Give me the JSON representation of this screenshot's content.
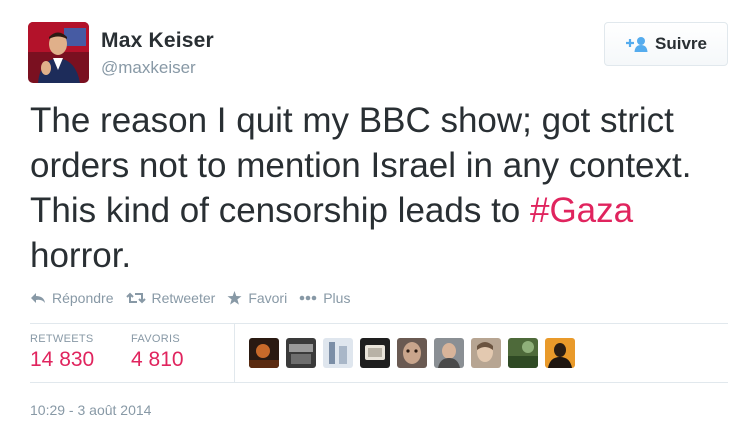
{
  "author": {
    "name": "Max Keiser",
    "handle": "@maxkeiser"
  },
  "follow_button": {
    "label": "Suivre",
    "icon": "add-user-icon"
  },
  "tweet": {
    "text_before": "The reason I quit my BBC show; got strict orders not to mention Israel in any context. This kind of censorship leads to ",
    "hashtag_symbol": "#",
    "hashtag_word": "Gaza",
    "text_after": " horror."
  },
  "actions": [
    {
      "label": "Répondre",
      "icon": "reply-icon"
    },
    {
      "label": "Retweeter",
      "icon": "retweet-icon"
    },
    {
      "label": "Favori",
      "icon": "star-icon"
    },
    {
      "label": "Plus",
      "icon": "more-dots-icon"
    }
  ],
  "stats": {
    "retweets_label": "RETWEETS",
    "retweets_value": "14 830",
    "favorites_label": "FAVORIS",
    "favorites_value": "4 810"
  },
  "favoriters_count_shown": 9,
  "timestamp": "10:29 - 3 août 2014",
  "colors": {
    "accent": "#e0245e",
    "muted": "#8899a6",
    "text": "#292f33",
    "border": "#e1e8ed"
  }
}
